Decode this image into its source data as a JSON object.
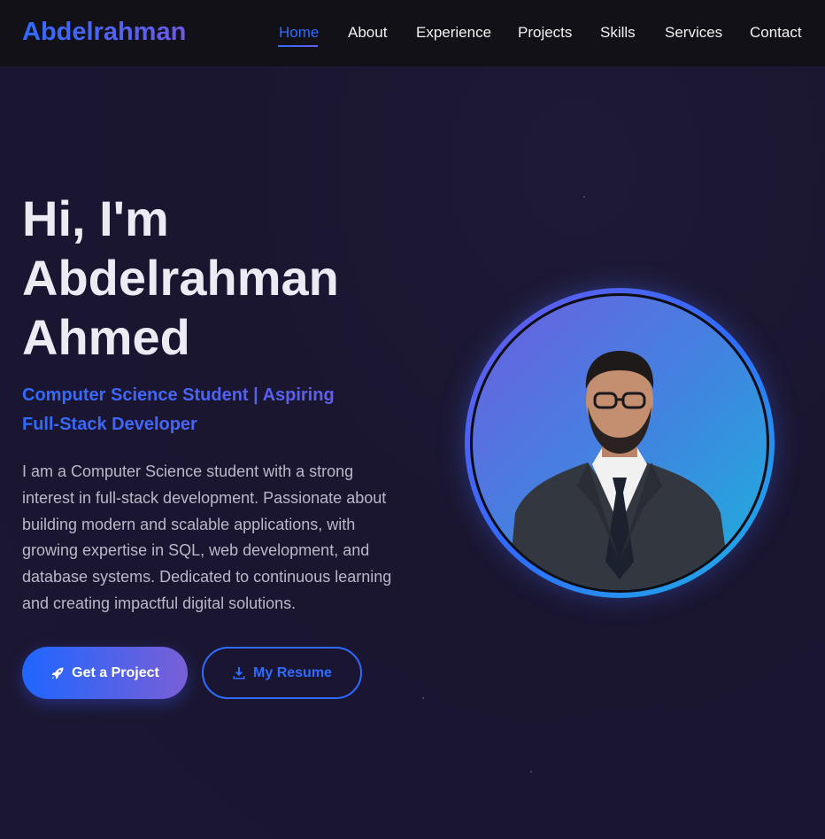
{
  "nav": {
    "logo": "Abdelrahman",
    "links": [
      {
        "label": "Home",
        "active": true
      },
      {
        "label": "About"
      },
      {
        "label": "Experience"
      },
      {
        "label": "Projects"
      },
      {
        "label": "Skills"
      },
      {
        "label": "Services"
      },
      {
        "label": "Contact"
      }
    ]
  },
  "hero": {
    "title_lines": [
      "Hi, I'm",
      "Abdelrahman",
      "Ahmed"
    ],
    "subtitle_lines": [
      "Computer Science Student | Aspiring",
      "Full-Stack Developer"
    ],
    "description": "I am a Computer Science student with a strong interest in full-stack development. Passionate about building modern and scalable applications, with growing expertise in SQL, web development, and database systems. Dedicated to continuous learning and creating impactful digital solutions.",
    "primary_button": {
      "label": "Get a Project",
      "icon": "rocket-icon"
    },
    "secondary_button": {
      "label": "My Resume",
      "icon": "download-icon"
    }
  },
  "colors": {
    "accent_blue": "#2f6bff",
    "accent_purple": "#6b5ce6",
    "accent_cyan": "#1eb4e0",
    "background": "#1b1733",
    "navbar": "#121118"
  }
}
